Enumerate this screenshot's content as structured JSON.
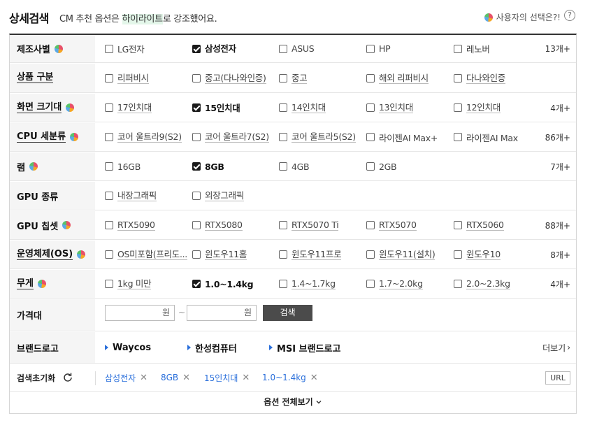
{
  "header": {
    "title": "상세검색",
    "subtitle_pre": "CM 추천 옵션은 ",
    "subtitle_hl": "하이라이트",
    "subtitle_post": "로 강조했어요.",
    "user_choice": "사용자의 선택은?!",
    "help": "?"
  },
  "rows": {
    "maker": {
      "label": "제조사별",
      "options": [
        "LG전자",
        "삼성전자",
        "ASUS",
        "HP",
        "레노버"
      ],
      "count": "13개+"
    },
    "type": {
      "label": "상품 구분",
      "options": [
        "리퍼비시",
        "중고(다나와인증)",
        "중고",
        "해외 리퍼비시",
        "다나와인증"
      ]
    },
    "screen": {
      "label": "화면 크기대",
      "options": [
        "17인치대",
        "15인치대",
        "14인치대",
        "13인치대",
        "12인치대"
      ],
      "count": "4개+"
    },
    "cpu": {
      "label": "CPU 세분류",
      "options": [
        "코어 울트라9(S2)",
        "코어 울트라7(S2)",
        "코어 울트라5(S2)",
        "라이젠AI Max+",
        "라이젠AI Max"
      ],
      "count": "86개+"
    },
    "ram": {
      "label": "램",
      "options": [
        "16GB",
        "8GB",
        "4GB",
        "2GB"
      ],
      "count": "7개+"
    },
    "gputype": {
      "label": "GPU 종류",
      "options": [
        "내장그래픽",
        "외장그래픽"
      ]
    },
    "gpuchip": {
      "label": "GPU 칩셋",
      "options": [
        "RTX5090",
        "RTX5080",
        "RTX5070 Ti",
        "RTX5070",
        "RTX5060"
      ],
      "count": "88개+"
    },
    "os": {
      "label": "운영체제(OS)",
      "options": [
        "OS미포함(프리도...",
        "윈도우11홈",
        "윈도우11프로",
        "윈도우11(설치)",
        "윈도우10"
      ],
      "count": "8개+"
    },
    "weight": {
      "label": "무게",
      "options": [
        "1kg 미만",
        "1.0~1.4kg",
        "1.4~1.7kg",
        "1.7~2.0kg",
        "2.0~2.3kg"
      ],
      "count": "4개+"
    },
    "price": {
      "label": "가격대",
      "unit": "원",
      "tilde": "~",
      "search": "검색"
    },
    "brand": {
      "label": "브랜드로고",
      "items": [
        "Waycos",
        "한성컴퓨터",
        "MSI 브랜드로고"
      ],
      "more": "더보기"
    }
  },
  "reset": {
    "label": "검색초기화",
    "chips": [
      "삼성전자",
      "8GB",
      "15인치대",
      "1.0~1.4kg"
    ],
    "chip_close": "✕",
    "url": "URL"
  },
  "footer": {
    "expand": "옵션 전체보기"
  },
  "colors": {
    "accent": "#2a6fdb",
    "search_button": "#4b4b4b"
  }
}
